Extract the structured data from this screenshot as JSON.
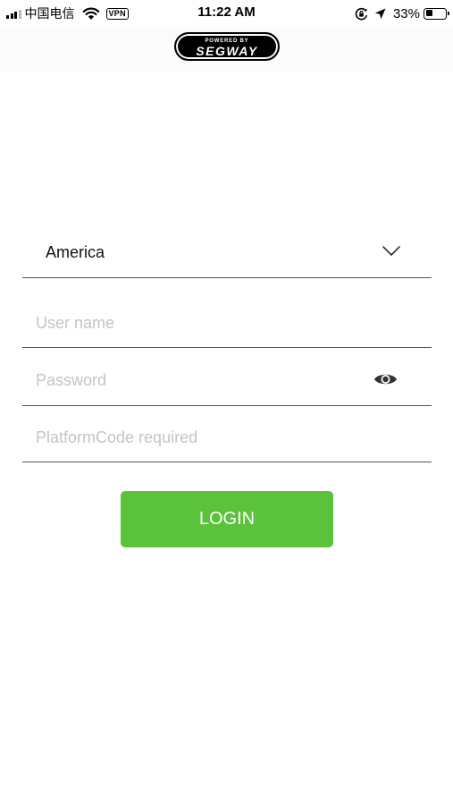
{
  "status_bar": {
    "carrier": "中国电信",
    "vpn": "VPN",
    "time": "11:22 AM",
    "battery_percent": "33%",
    "battery_level": 0.33,
    "icons": [
      "signal-icon",
      "wifi-icon",
      "orientation-lock-icon",
      "location-arrow-icon",
      "battery-icon"
    ]
  },
  "header": {
    "logo_top": "POWERED BY",
    "logo_main": "SEGWAY"
  },
  "form": {
    "region": {
      "value": "America",
      "icon": "chevron-down-icon"
    },
    "username": {
      "value": "",
      "placeholder": "User name"
    },
    "password": {
      "value": "",
      "placeholder": "Password",
      "icon": "eye-icon"
    },
    "platform_code": {
      "value": "",
      "placeholder": "PlatformCode required"
    },
    "login_label": "LOGIN"
  },
  "colors": {
    "accent": "#5ac23b",
    "divider": "#555555",
    "placeholder": "#c4c4c4",
    "icon": "#333333"
  }
}
